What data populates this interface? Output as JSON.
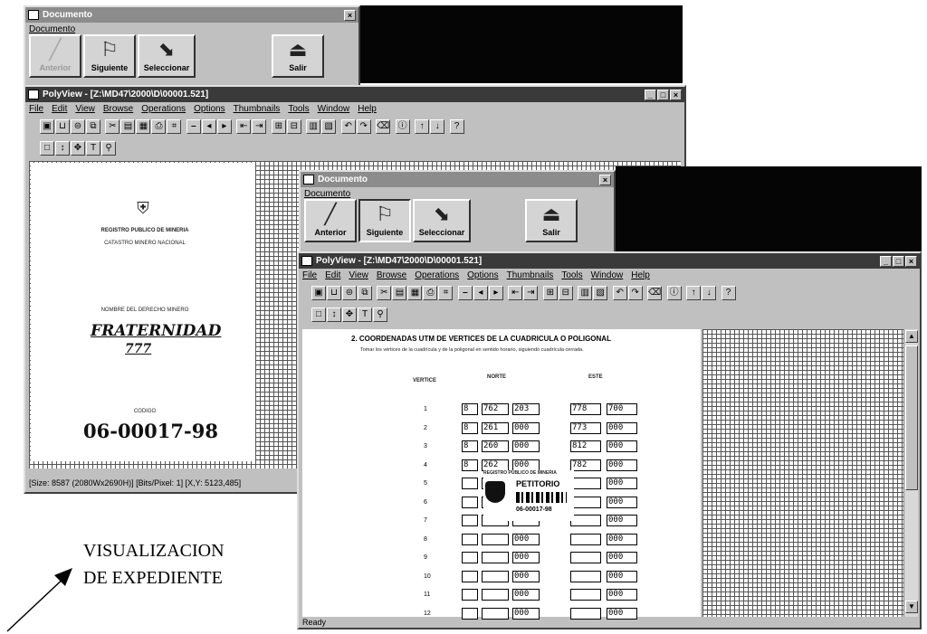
{
  "back_window": {
    "title": "Documento",
    "menu": "Documento",
    "buttons": [
      {
        "label": "Anterior"
      },
      {
        "label": "Siguiente"
      },
      {
        "label": "Seleccionar"
      },
      {
        "label": "Salir"
      }
    ]
  },
  "back_polyview": {
    "title": "PolyView - [Z:\\MD47\\2000\\D\\00001.521]",
    "menu": [
      "File",
      "Edit",
      "View",
      "Browse",
      "Operations",
      "Options",
      "Thumbnails",
      "Tools",
      "Window",
      "Help"
    ],
    "status": "[Size: 8587 (2080Wx2690H)] [Bits/Pixel: 1] [X,Y: 5123,485]",
    "document": {
      "org": "REGISTRO PUBLICO DE MINERIA",
      "subtitle": "CATASTRO MINERO NACIONAL",
      "label_name": "NOMBRE DEL DERECHO MINERO",
      "claim_name": "FRATERNIDAD",
      "claim_num": "777",
      "label_code": "CODIGO",
      "code": "06-00017-98"
    }
  },
  "front_window": {
    "title": "Documento",
    "menu": "Documento",
    "buttons": [
      {
        "label": "Anterior"
      },
      {
        "label": "Siguiente"
      },
      {
        "label": "Seleccionar"
      },
      {
        "label": "Salir"
      }
    ]
  },
  "front_polyview": {
    "title": "PolyView - [Z:\\MD47\\2000\\D\\00001.521]",
    "menu": [
      "File",
      "Edit",
      "View",
      "Browse",
      "Operations",
      "Options",
      "Thumbnails",
      "Tools",
      "Window",
      "Help"
    ],
    "status": "Ready",
    "form": {
      "heading": "2.   COORDENADAS UTM DE VERTICES DE LA CUADRICULA O POLIGONAL",
      "instruction": "Tomar los vértices de la cuadrícula y de la poligonal en sentido horario, siguiendo cuadrícula cerrada.",
      "col_vertice": "VERTICE",
      "col_norte": "NORTE",
      "col_este": "ESTE",
      "rows": [
        {
          "n": "1",
          "norte": [
            "8",
            "762",
            "203"
          ],
          "este": [
            "778",
            "700"
          ]
        },
        {
          "n": "2",
          "norte": [
            "8",
            "261",
            "000"
          ],
          "este": [
            "773",
            "000"
          ]
        },
        {
          "n": "3",
          "norte": [
            "8",
            "260",
            "000"
          ],
          "este": [
            "812",
            "000"
          ]
        },
        {
          "n": "4",
          "norte": [
            "8",
            "262",
            "000"
          ],
          "este": [
            "782",
            "000"
          ]
        },
        {
          "n": "5",
          "norte": [
            "",
            "",
            ""
          ],
          "este": [
            "",
            "000"
          ]
        },
        {
          "n": "6",
          "norte": [
            "",
            "",
            ""
          ],
          "este": [
            "",
            "000"
          ]
        },
        {
          "n": "7",
          "norte": [
            "",
            "",
            ""
          ],
          "este": [
            "",
            "000"
          ]
        },
        {
          "n": "8",
          "norte": [
            "",
            "",
            "000"
          ],
          "este": [
            "",
            "000"
          ]
        },
        {
          "n": "9",
          "norte": [
            "",
            "",
            "000"
          ],
          "este": [
            "",
            "000"
          ]
        },
        {
          "n": "10",
          "norte": [
            "",
            "",
            "000"
          ],
          "este": [
            "",
            "000"
          ]
        },
        {
          "n": "11",
          "norte": [
            "",
            "",
            "000"
          ],
          "este": [
            "",
            "000"
          ]
        },
        {
          "n": "12",
          "norte": [
            "",
            "",
            "000"
          ],
          "este": [
            "",
            "000"
          ]
        }
      ],
      "stamp_org": "REGISTRO PUBLICO DE MINERIA",
      "stamp_title": "PETITORIO",
      "stamp_code": "06-00017-98"
    }
  },
  "caption": {
    "line1": "VISUALIZACION",
    "line2": "DE EXPEDIENTE"
  }
}
